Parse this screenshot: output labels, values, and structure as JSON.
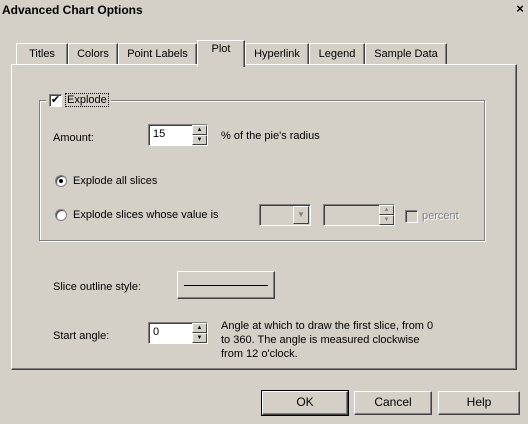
{
  "window": {
    "title": "Advanced Chart Options",
    "close_glyph": "×"
  },
  "tabs": [
    {
      "label": "Titles"
    },
    {
      "label": "Colors"
    },
    {
      "label": "Point Labels"
    },
    {
      "label": "Plot",
      "active": true
    },
    {
      "label": "Hyperlink"
    },
    {
      "label": "Legend"
    },
    {
      "label": "Sample Data"
    }
  ],
  "explode": {
    "label": "Explode",
    "checked": true,
    "amount_label": "Amount:",
    "amount_value": "15",
    "amount_suffix": "% of the pie's radius",
    "radio_all": "Explode all slices",
    "radio_some": "Explode slices whose value is",
    "selected_radio": "all",
    "percent_label": "percent"
  },
  "slice_outline": {
    "label": "Slice outline style:"
  },
  "start_angle": {
    "label": "Start angle:",
    "value": "0",
    "help_line1": "Angle at which to draw the first slice, from 0",
    "help_line2": "to 360. The angle is measured clockwise",
    "help_line3": "from 12 o'clock."
  },
  "buttons": {
    "ok": "OK",
    "cancel": "Cancel",
    "help": "Help"
  },
  "icons": {
    "check": "checkmark-icon",
    "spin_up": "up-arrow-icon",
    "spin_down": "down-arrow-icon",
    "dropdown": "chevron-down-icon"
  }
}
